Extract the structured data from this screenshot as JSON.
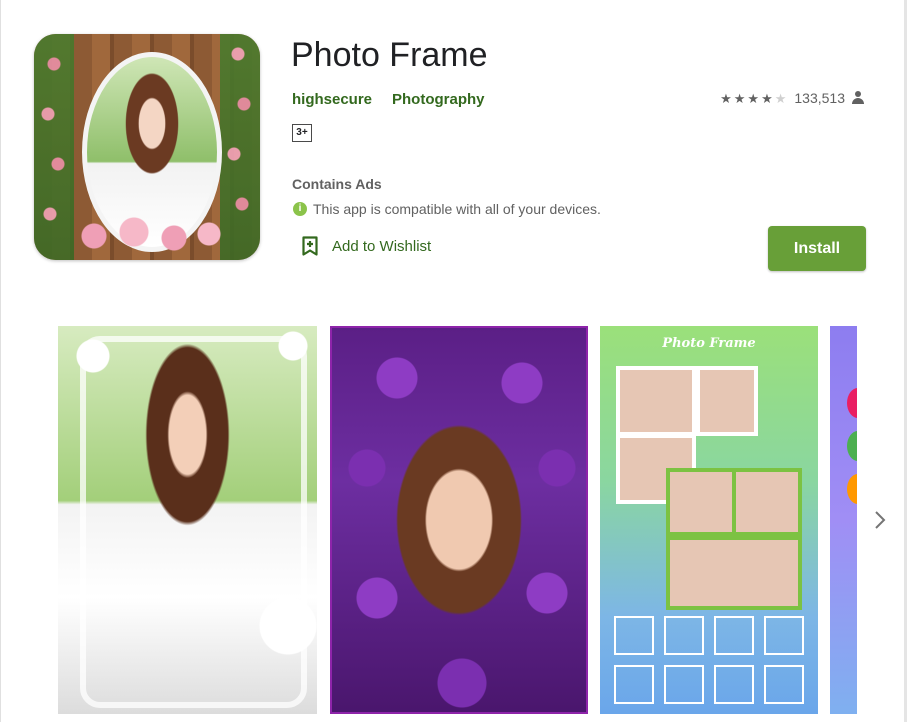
{
  "app": {
    "title": "Photo Frame",
    "developer": "highsecure",
    "category": "Photography",
    "content_rating": "3+",
    "rating_stars": 4,
    "rating_max": 5,
    "rating_count": "133,513",
    "contains_ads": "Contains Ads",
    "compatibility": "This app is compatible with all of your devices.",
    "wishlist_label": "Add to Wishlist",
    "install_label": "Install"
  },
  "colors": {
    "accent_green": "#689f38",
    "link_green": "#33691e",
    "text_gray": "#616161"
  },
  "screenshots": {
    "shot3_banner": "Photo Frame"
  },
  "icons": {
    "rating": "star-icon",
    "user": "person-icon",
    "info": "info-icon",
    "wishlist": "bookmark-add-icon",
    "next": "chevron-right-icon"
  }
}
